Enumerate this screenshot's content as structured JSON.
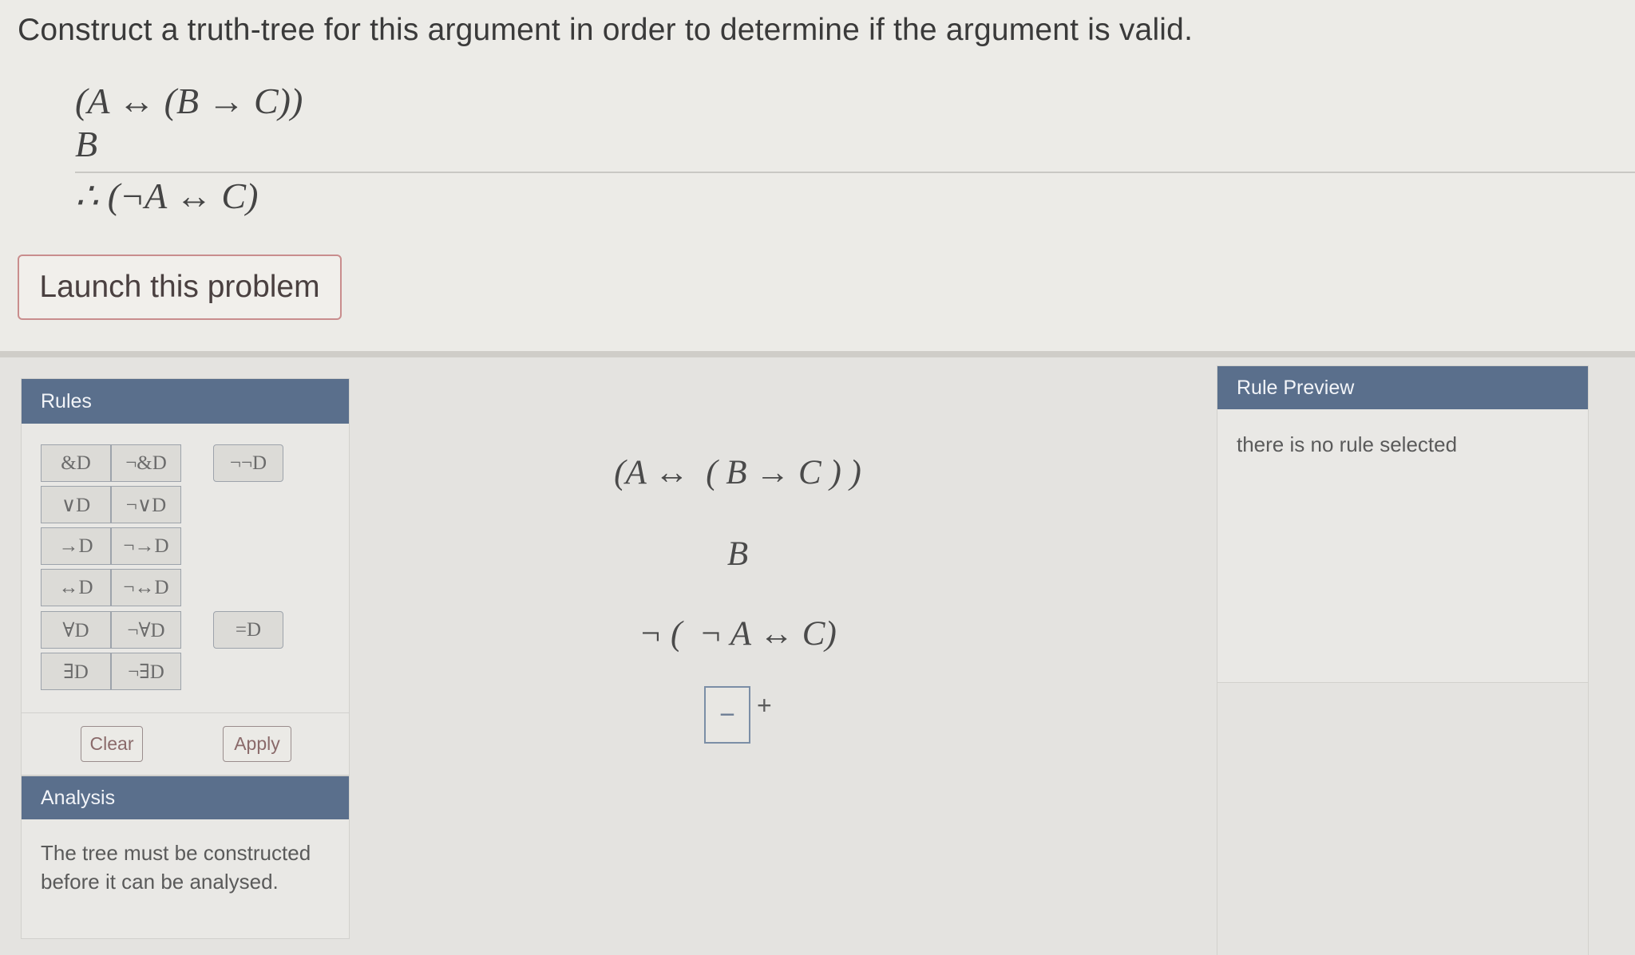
{
  "question": {
    "instruction": "Construct a truth-tree for this argument in order to determine if the argument is valid.",
    "premises": [
      "(A ↔ (B → C))",
      "B"
    ],
    "conclusion": "∴ (¬A ↔ C)",
    "launch_label": "Launch this problem"
  },
  "rules_panel": {
    "title": "Rules",
    "buttons": {
      "and_d": "&D",
      "neg_and_d": "¬&D",
      "dneg_d": "¬¬D",
      "or_d": "∨D",
      "neg_or_d": "¬∨D",
      "cond_d": "→D",
      "neg_cond_d": "¬→D",
      "bicond_d": "↔D",
      "neg_bicond_d": "¬↔D",
      "forall_d": "∀D",
      "neg_forall_d": "¬∀D",
      "eq_d": "=D",
      "exists_d": "∃D",
      "neg_exists_d": "¬∃D"
    },
    "clear_label": "Clear",
    "apply_label": "Apply"
  },
  "analysis_panel": {
    "title": "Analysis",
    "message": "The tree must be constructed before it can be analysed."
  },
  "tree": {
    "lines": [
      "(A ↔  ( B → C ) )",
      "B",
      "¬ (  ¬ A ↔ C)"
    ],
    "collapse_symbol": "−",
    "add_symbol": "+"
  },
  "rule_preview": {
    "title": "Rule Preview",
    "message": "there is no rule selected"
  }
}
